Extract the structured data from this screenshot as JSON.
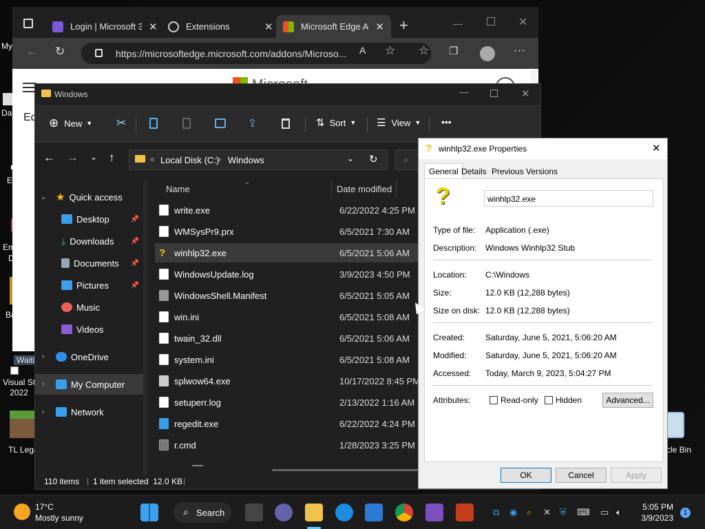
{
  "desktop": {
    "icons": [
      {
        "label": "Visual St\n2022"
      },
      {
        "label": "TL Lega"
      },
      {
        "label": "cle Bin"
      }
    ],
    "partial_labels": [
      "My",
      "Da",
      "E",
      "Em",
      "D",
      "Ba",
      "Waiti"
    ]
  },
  "edge": {
    "tabs": [
      {
        "label": "Login | Microsoft 3",
        "icon": "microsoft365-icon",
        "color": "#7b5cd6"
      },
      {
        "label": "Extensions",
        "icon": "puzzle-icon",
        "color": "#cfcfcf"
      },
      {
        "label": "Microsoft Edge Adc",
        "icon": "microsoft-logo-icon",
        "color": "#f25022"
      }
    ],
    "url": "https://microsoftedge.microsoft.com/addons/Microso...",
    "page_brand": "Microsoft",
    "page_partial": "Ed"
  },
  "explorer": {
    "title": "Windows",
    "toolbar": {
      "new": "New",
      "sort": "Sort",
      "view": "View",
      "more": "•••"
    },
    "breadcrumb": {
      "drive": "Local Disk (C:)",
      "folder": "Windows"
    },
    "nav": [
      {
        "label": "Quick access",
        "icon": "star-icon",
        "color": "#f5c400",
        "level": 0,
        "expanded": true
      },
      {
        "label": "Desktop",
        "icon": "desktop-icon",
        "color": "#3b9ee8",
        "level": 1,
        "pinned": true
      },
      {
        "label": "Downloads",
        "icon": "download-icon",
        "color": "#2bb673",
        "level": 1,
        "pinned": true
      },
      {
        "label": "Documents",
        "icon": "documents-icon",
        "color": "#9aa6b2",
        "level": 1,
        "pinned": true
      },
      {
        "label": "Pictures",
        "icon": "pictures-icon",
        "color": "#3b9ee8",
        "level": 1,
        "pinned": true
      },
      {
        "label": "Music",
        "icon": "music-icon",
        "color": "#e8625a",
        "level": 1,
        "pinned": false
      },
      {
        "label": "Videos",
        "icon": "videos-icon",
        "color": "#8a5cd6",
        "level": 1,
        "pinned": false
      },
      {
        "label": "OneDrive",
        "icon": "cloud-icon",
        "color": "#2f8fe8",
        "level": 0
      },
      {
        "label": "My Computer",
        "icon": "computer-icon",
        "color": "#3b9ee8",
        "level": 0,
        "selected": true
      },
      {
        "label": "Network",
        "icon": "network-icon",
        "color": "#3b9ee8",
        "level": 0
      }
    ],
    "columns": {
      "name": "Name",
      "date": "Date modified"
    },
    "files": [
      {
        "name": "write.exe",
        "date": "6/22/2022 4:25 PM",
        "icon": "app-icon"
      },
      {
        "name": "WMSysPr9.prx",
        "date": "6/5/2021 7:30 AM",
        "icon": "file-icon"
      },
      {
        "name": "winhlp32.exe",
        "date": "6/5/2021 5:06 AM",
        "icon": "help-icon",
        "selected": true
      },
      {
        "name": "WindowsUpdate.log",
        "date": "3/9/2023 4:50 PM",
        "icon": "text-file-icon"
      },
      {
        "name": "WindowsShell.Manifest",
        "date": "6/5/2021 5:05 AM",
        "icon": "file-icon"
      },
      {
        "name": "win.ini",
        "date": "6/5/2021 5:08 AM",
        "icon": "settings-file-icon"
      },
      {
        "name": "twain_32.dll",
        "date": "6/5/2021 5:06 AM",
        "icon": "dll-icon"
      },
      {
        "name": "system.ini",
        "date": "6/5/2021 5:08 AM",
        "icon": "settings-file-icon"
      },
      {
        "name": "splwow64.exe",
        "date": "10/17/2022 8:45 PM",
        "icon": "printer-icon"
      },
      {
        "name": "setuperr.log",
        "date": "2/13/2022 1:16 AM",
        "icon": "text-file-icon"
      },
      {
        "name": "regedit.exe",
        "date": "6/22/2022 4:24 PM",
        "icon": "registry-icon"
      },
      {
        "name": "r.cmd",
        "date": "1/28/2023 3:25 PM",
        "icon": "cmd-icon"
      }
    ],
    "status": {
      "count": "110 items",
      "selection": "1 item selected  12.0 KB"
    }
  },
  "properties": {
    "title": "winhlp32.exe Properties",
    "tabs": [
      "General",
      "Details",
      "Previous Versions"
    ],
    "filename": "winhlp32.exe",
    "fields": {
      "type_label": "Type of file:",
      "type": "Application (.exe)",
      "desc_label": "Description:",
      "desc": "Windows Winhlp32 Stub",
      "loc_label": "Location:",
      "loc": "C:\\Windows",
      "size_label": "Size:",
      "size": "12.0 KB (12,288 bytes)",
      "disk_label": "Size on disk:",
      "disk": "12.0 KB (12,288 bytes)",
      "created_label": "Created:",
      "created": "Saturday, June 5, 2021, 5:06:20 AM",
      "modified_label": "Modified:",
      "modified": "Saturday, June 5, 2021, 5:06:20 AM",
      "accessed_label": "Accessed:",
      "accessed": "Today, March 9, 2023, 5:04:27 PM",
      "attr_label": "Attributes:",
      "readonly": "Read-only",
      "hidden": "Hidden"
    },
    "buttons": {
      "advanced": "Advanced...",
      "ok": "OK",
      "cancel": "Cancel",
      "apply": "Apply"
    }
  },
  "taskbar": {
    "weather_temp": "17°C",
    "weather_desc": "Mostly sunny",
    "search": "Search",
    "time": "5:05 PM",
    "date": "3/9/2023",
    "notifications": "1"
  }
}
